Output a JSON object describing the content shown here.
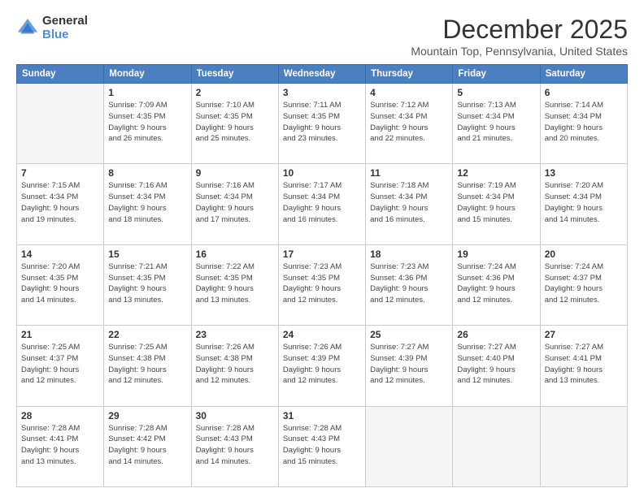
{
  "logo": {
    "general": "General",
    "blue": "Blue"
  },
  "header": {
    "month_title": "December 2025",
    "location": "Mountain Top, Pennsylvania, United States"
  },
  "weekdays": [
    "Sunday",
    "Monday",
    "Tuesday",
    "Wednesday",
    "Thursday",
    "Friday",
    "Saturday"
  ],
  "weeks": [
    [
      {
        "day": "",
        "info": ""
      },
      {
        "day": "1",
        "info": "Sunrise: 7:09 AM\nSunset: 4:35 PM\nDaylight: 9 hours\nand 26 minutes."
      },
      {
        "day": "2",
        "info": "Sunrise: 7:10 AM\nSunset: 4:35 PM\nDaylight: 9 hours\nand 25 minutes."
      },
      {
        "day": "3",
        "info": "Sunrise: 7:11 AM\nSunset: 4:35 PM\nDaylight: 9 hours\nand 23 minutes."
      },
      {
        "day": "4",
        "info": "Sunrise: 7:12 AM\nSunset: 4:34 PM\nDaylight: 9 hours\nand 22 minutes."
      },
      {
        "day": "5",
        "info": "Sunrise: 7:13 AM\nSunset: 4:34 PM\nDaylight: 9 hours\nand 21 minutes."
      },
      {
        "day": "6",
        "info": "Sunrise: 7:14 AM\nSunset: 4:34 PM\nDaylight: 9 hours\nand 20 minutes."
      }
    ],
    [
      {
        "day": "7",
        "info": "Sunrise: 7:15 AM\nSunset: 4:34 PM\nDaylight: 9 hours\nand 19 minutes."
      },
      {
        "day": "8",
        "info": "Sunrise: 7:16 AM\nSunset: 4:34 PM\nDaylight: 9 hours\nand 18 minutes."
      },
      {
        "day": "9",
        "info": "Sunrise: 7:16 AM\nSunset: 4:34 PM\nDaylight: 9 hours\nand 17 minutes."
      },
      {
        "day": "10",
        "info": "Sunrise: 7:17 AM\nSunset: 4:34 PM\nDaylight: 9 hours\nand 16 minutes."
      },
      {
        "day": "11",
        "info": "Sunrise: 7:18 AM\nSunset: 4:34 PM\nDaylight: 9 hours\nand 16 minutes."
      },
      {
        "day": "12",
        "info": "Sunrise: 7:19 AM\nSunset: 4:34 PM\nDaylight: 9 hours\nand 15 minutes."
      },
      {
        "day": "13",
        "info": "Sunrise: 7:20 AM\nSunset: 4:34 PM\nDaylight: 9 hours\nand 14 minutes."
      }
    ],
    [
      {
        "day": "14",
        "info": "Sunrise: 7:20 AM\nSunset: 4:35 PM\nDaylight: 9 hours\nand 14 minutes."
      },
      {
        "day": "15",
        "info": "Sunrise: 7:21 AM\nSunset: 4:35 PM\nDaylight: 9 hours\nand 13 minutes."
      },
      {
        "day": "16",
        "info": "Sunrise: 7:22 AM\nSunset: 4:35 PM\nDaylight: 9 hours\nand 13 minutes."
      },
      {
        "day": "17",
        "info": "Sunrise: 7:23 AM\nSunset: 4:35 PM\nDaylight: 9 hours\nand 12 minutes."
      },
      {
        "day": "18",
        "info": "Sunrise: 7:23 AM\nSunset: 4:36 PM\nDaylight: 9 hours\nand 12 minutes."
      },
      {
        "day": "19",
        "info": "Sunrise: 7:24 AM\nSunset: 4:36 PM\nDaylight: 9 hours\nand 12 minutes."
      },
      {
        "day": "20",
        "info": "Sunrise: 7:24 AM\nSunset: 4:37 PM\nDaylight: 9 hours\nand 12 minutes."
      }
    ],
    [
      {
        "day": "21",
        "info": "Sunrise: 7:25 AM\nSunset: 4:37 PM\nDaylight: 9 hours\nand 12 minutes."
      },
      {
        "day": "22",
        "info": "Sunrise: 7:25 AM\nSunset: 4:38 PM\nDaylight: 9 hours\nand 12 minutes."
      },
      {
        "day": "23",
        "info": "Sunrise: 7:26 AM\nSunset: 4:38 PM\nDaylight: 9 hours\nand 12 minutes."
      },
      {
        "day": "24",
        "info": "Sunrise: 7:26 AM\nSunset: 4:39 PM\nDaylight: 9 hours\nand 12 minutes."
      },
      {
        "day": "25",
        "info": "Sunrise: 7:27 AM\nSunset: 4:39 PM\nDaylight: 9 hours\nand 12 minutes."
      },
      {
        "day": "26",
        "info": "Sunrise: 7:27 AM\nSunset: 4:40 PM\nDaylight: 9 hours\nand 12 minutes."
      },
      {
        "day": "27",
        "info": "Sunrise: 7:27 AM\nSunset: 4:41 PM\nDaylight: 9 hours\nand 13 minutes."
      }
    ],
    [
      {
        "day": "28",
        "info": "Sunrise: 7:28 AM\nSunset: 4:41 PM\nDaylight: 9 hours\nand 13 minutes."
      },
      {
        "day": "29",
        "info": "Sunrise: 7:28 AM\nSunset: 4:42 PM\nDaylight: 9 hours\nand 14 minutes."
      },
      {
        "day": "30",
        "info": "Sunrise: 7:28 AM\nSunset: 4:43 PM\nDaylight: 9 hours\nand 14 minutes."
      },
      {
        "day": "31",
        "info": "Sunrise: 7:28 AM\nSunset: 4:43 PM\nDaylight: 9 hours\nand 15 minutes."
      },
      {
        "day": "",
        "info": ""
      },
      {
        "day": "",
        "info": ""
      },
      {
        "day": "",
        "info": ""
      }
    ]
  ]
}
